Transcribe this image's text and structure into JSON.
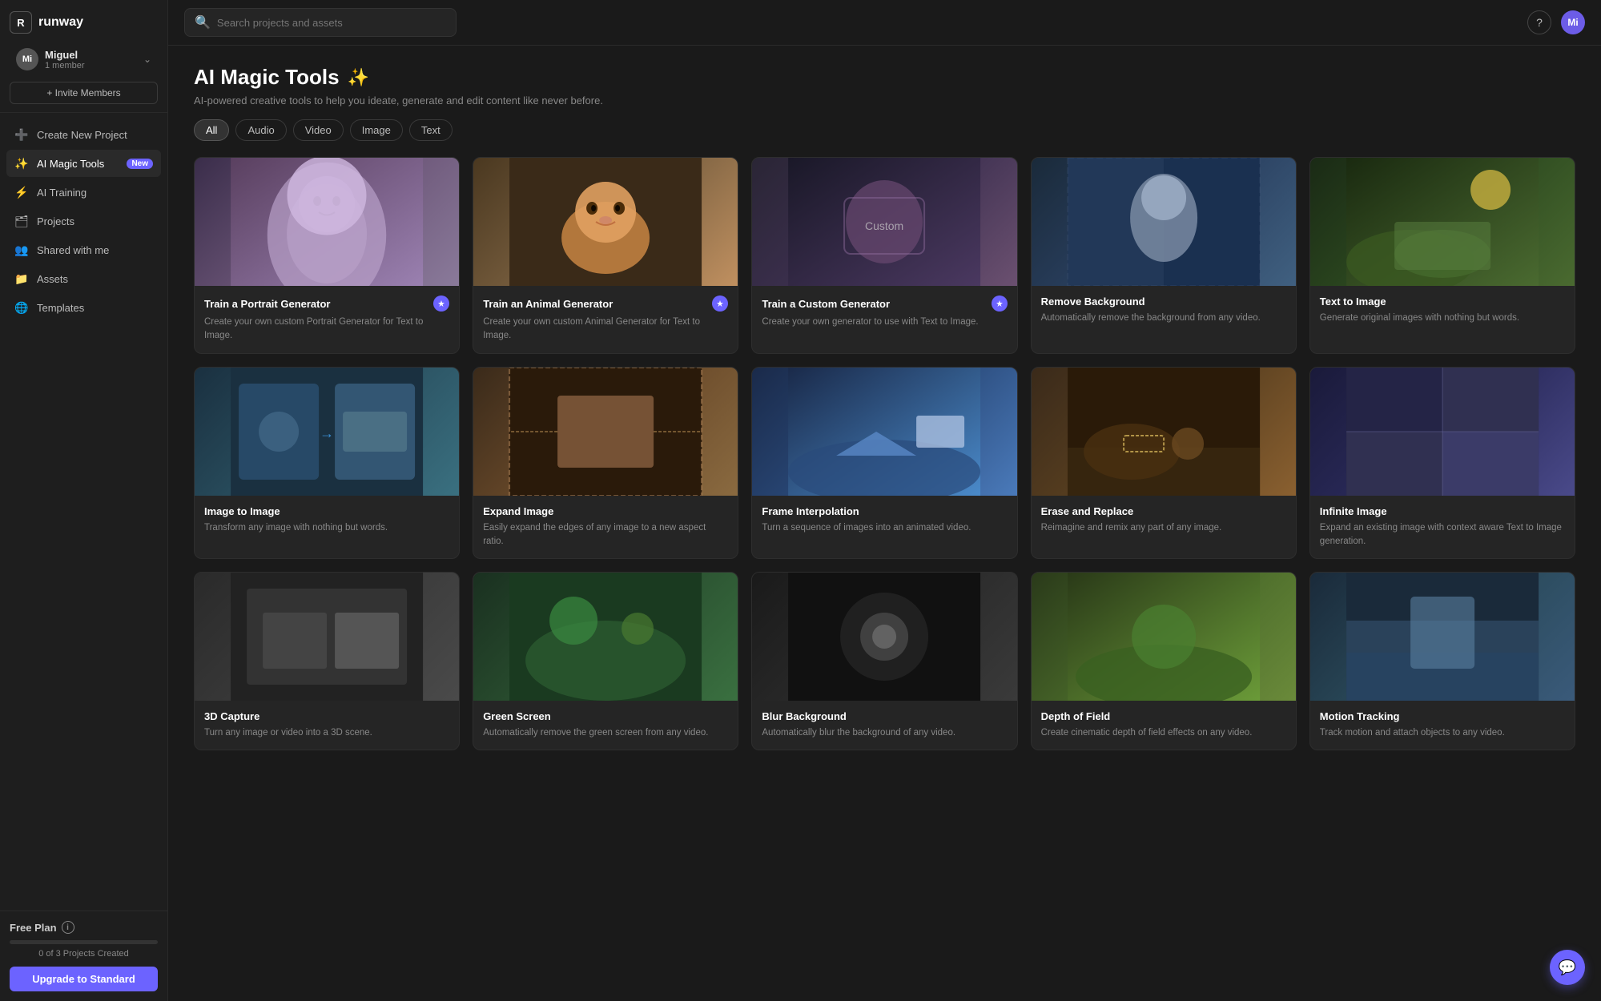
{
  "logo": {
    "icon": "R",
    "text": "runway"
  },
  "user": {
    "initials": "Mi",
    "name": "Miguel",
    "members": "1 member"
  },
  "invite_btn": "+ Invite Members",
  "nav": {
    "items": [
      {
        "id": "create-project",
        "label": "Create New Project",
        "icon": "➕"
      },
      {
        "id": "ai-magic-tools",
        "label": "AI Magic Tools",
        "icon": "✨",
        "badge": "New",
        "active": true
      },
      {
        "id": "ai-training",
        "label": "AI Training",
        "icon": "⚡"
      },
      {
        "id": "projects",
        "label": "Projects",
        "icon": "🗂"
      },
      {
        "id": "shared",
        "label": "Shared with me",
        "icon": "👥"
      },
      {
        "id": "assets",
        "label": "Assets",
        "icon": "📁"
      },
      {
        "id": "templates",
        "label": "Templates",
        "icon": "🌐"
      }
    ]
  },
  "sidebar_bottom": {
    "plan_label": "Free Plan",
    "progress_percent": 0,
    "projects_count": "0 of 3 Projects Created",
    "upgrade_label": "Upgrade to Standard"
  },
  "topbar": {
    "search_placeholder": "Search projects and assets",
    "help_icon": "?",
    "user_initials": "Mi"
  },
  "page": {
    "title": "AI Magic Tools",
    "wand": "✨",
    "subtitle": "AI-powered creative tools to help you ideate, generate and edit content like never before.",
    "filters": [
      {
        "id": "all",
        "label": "All",
        "active": true
      },
      {
        "id": "audio",
        "label": "Audio",
        "active": false
      },
      {
        "id": "video",
        "label": "Video",
        "active": false
      },
      {
        "id": "image",
        "label": "Image",
        "active": false
      },
      {
        "id": "text",
        "label": "Text",
        "active": false
      }
    ]
  },
  "tools": [
    {
      "id": "portrait-generator",
      "name": "Train a Portrait Generator",
      "desc": "Create your own custom Portrait Generator for Text to Image.",
      "thumb_class": "thumb-portrait",
      "has_badge": true
    },
    {
      "id": "animal-generator",
      "name": "Train an Animal Generator",
      "desc": "Create your own custom Animal Generator for Text to Image.",
      "thumb_class": "thumb-animal",
      "has_badge": true
    },
    {
      "id": "custom-generator",
      "name": "Train a Custom Generator",
      "desc": "Create your own generator to use with Text to Image.",
      "thumb_class": "thumb-custom",
      "has_badge": true
    },
    {
      "id": "remove-background",
      "name": "Remove Background",
      "desc": "Automatically remove the background from any video.",
      "thumb_class": "thumb-remove-bg",
      "has_badge": false
    },
    {
      "id": "text-to-image",
      "name": "Text to Image",
      "desc": "Generate original images with nothing but words.",
      "thumb_class": "thumb-text-to-image",
      "has_badge": false
    },
    {
      "id": "image-to-image",
      "name": "Image to Image",
      "desc": "Transform any image with nothing but words.",
      "thumb_class": "thumb-img2img",
      "has_badge": false
    },
    {
      "id": "expand-image",
      "name": "Expand Image",
      "desc": "Easily expand the edges of any image to a new aspect ratio.",
      "thumb_class": "thumb-expand",
      "has_badge": false
    },
    {
      "id": "frame-interpolation",
      "name": "Frame Interpolation",
      "desc": "Turn a sequence of images into an animated video.",
      "thumb_class": "thumb-frame",
      "has_badge": false
    },
    {
      "id": "erase-replace",
      "name": "Erase and Replace",
      "desc": "Reimagine and remix any part of any image.",
      "thumb_class": "thumb-erase",
      "has_badge": false
    },
    {
      "id": "infinite-image",
      "name": "Infinite Image",
      "desc": "Expand an existing image with context aware Text to Image generation.",
      "thumb_class": "thumb-infinite",
      "has_badge": false
    },
    {
      "id": "tool-row3-1",
      "name": "3D Capture",
      "desc": "Turn any image or video into a 3D scene.",
      "thumb_class": "thumb-row3-1",
      "has_badge": false
    },
    {
      "id": "tool-row3-2",
      "name": "Green Screen",
      "desc": "Automatically remove the green screen from any video.",
      "thumb_class": "thumb-row3-2",
      "has_badge": false
    },
    {
      "id": "tool-row3-3",
      "name": "Blur Background",
      "desc": "Automatically blur the background of any video.",
      "thumb_class": "thumb-row3-3",
      "has_badge": false
    },
    {
      "id": "tool-row3-4",
      "name": "Depth of Field",
      "desc": "Create cinematic depth of field effects on any video.",
      "thumb_class": "thumb-row3-4",
      "has_badge": false
    },
    {
      "id": "tool-row3-5",
      "name": "Motion Tracking",
      "desc": "Track motion and attach objects to any video.",
      "thumb_class": "thumb-row3-5",
      "has_badge": false
    }
  ],
  "chat_icon": "💬"
}
